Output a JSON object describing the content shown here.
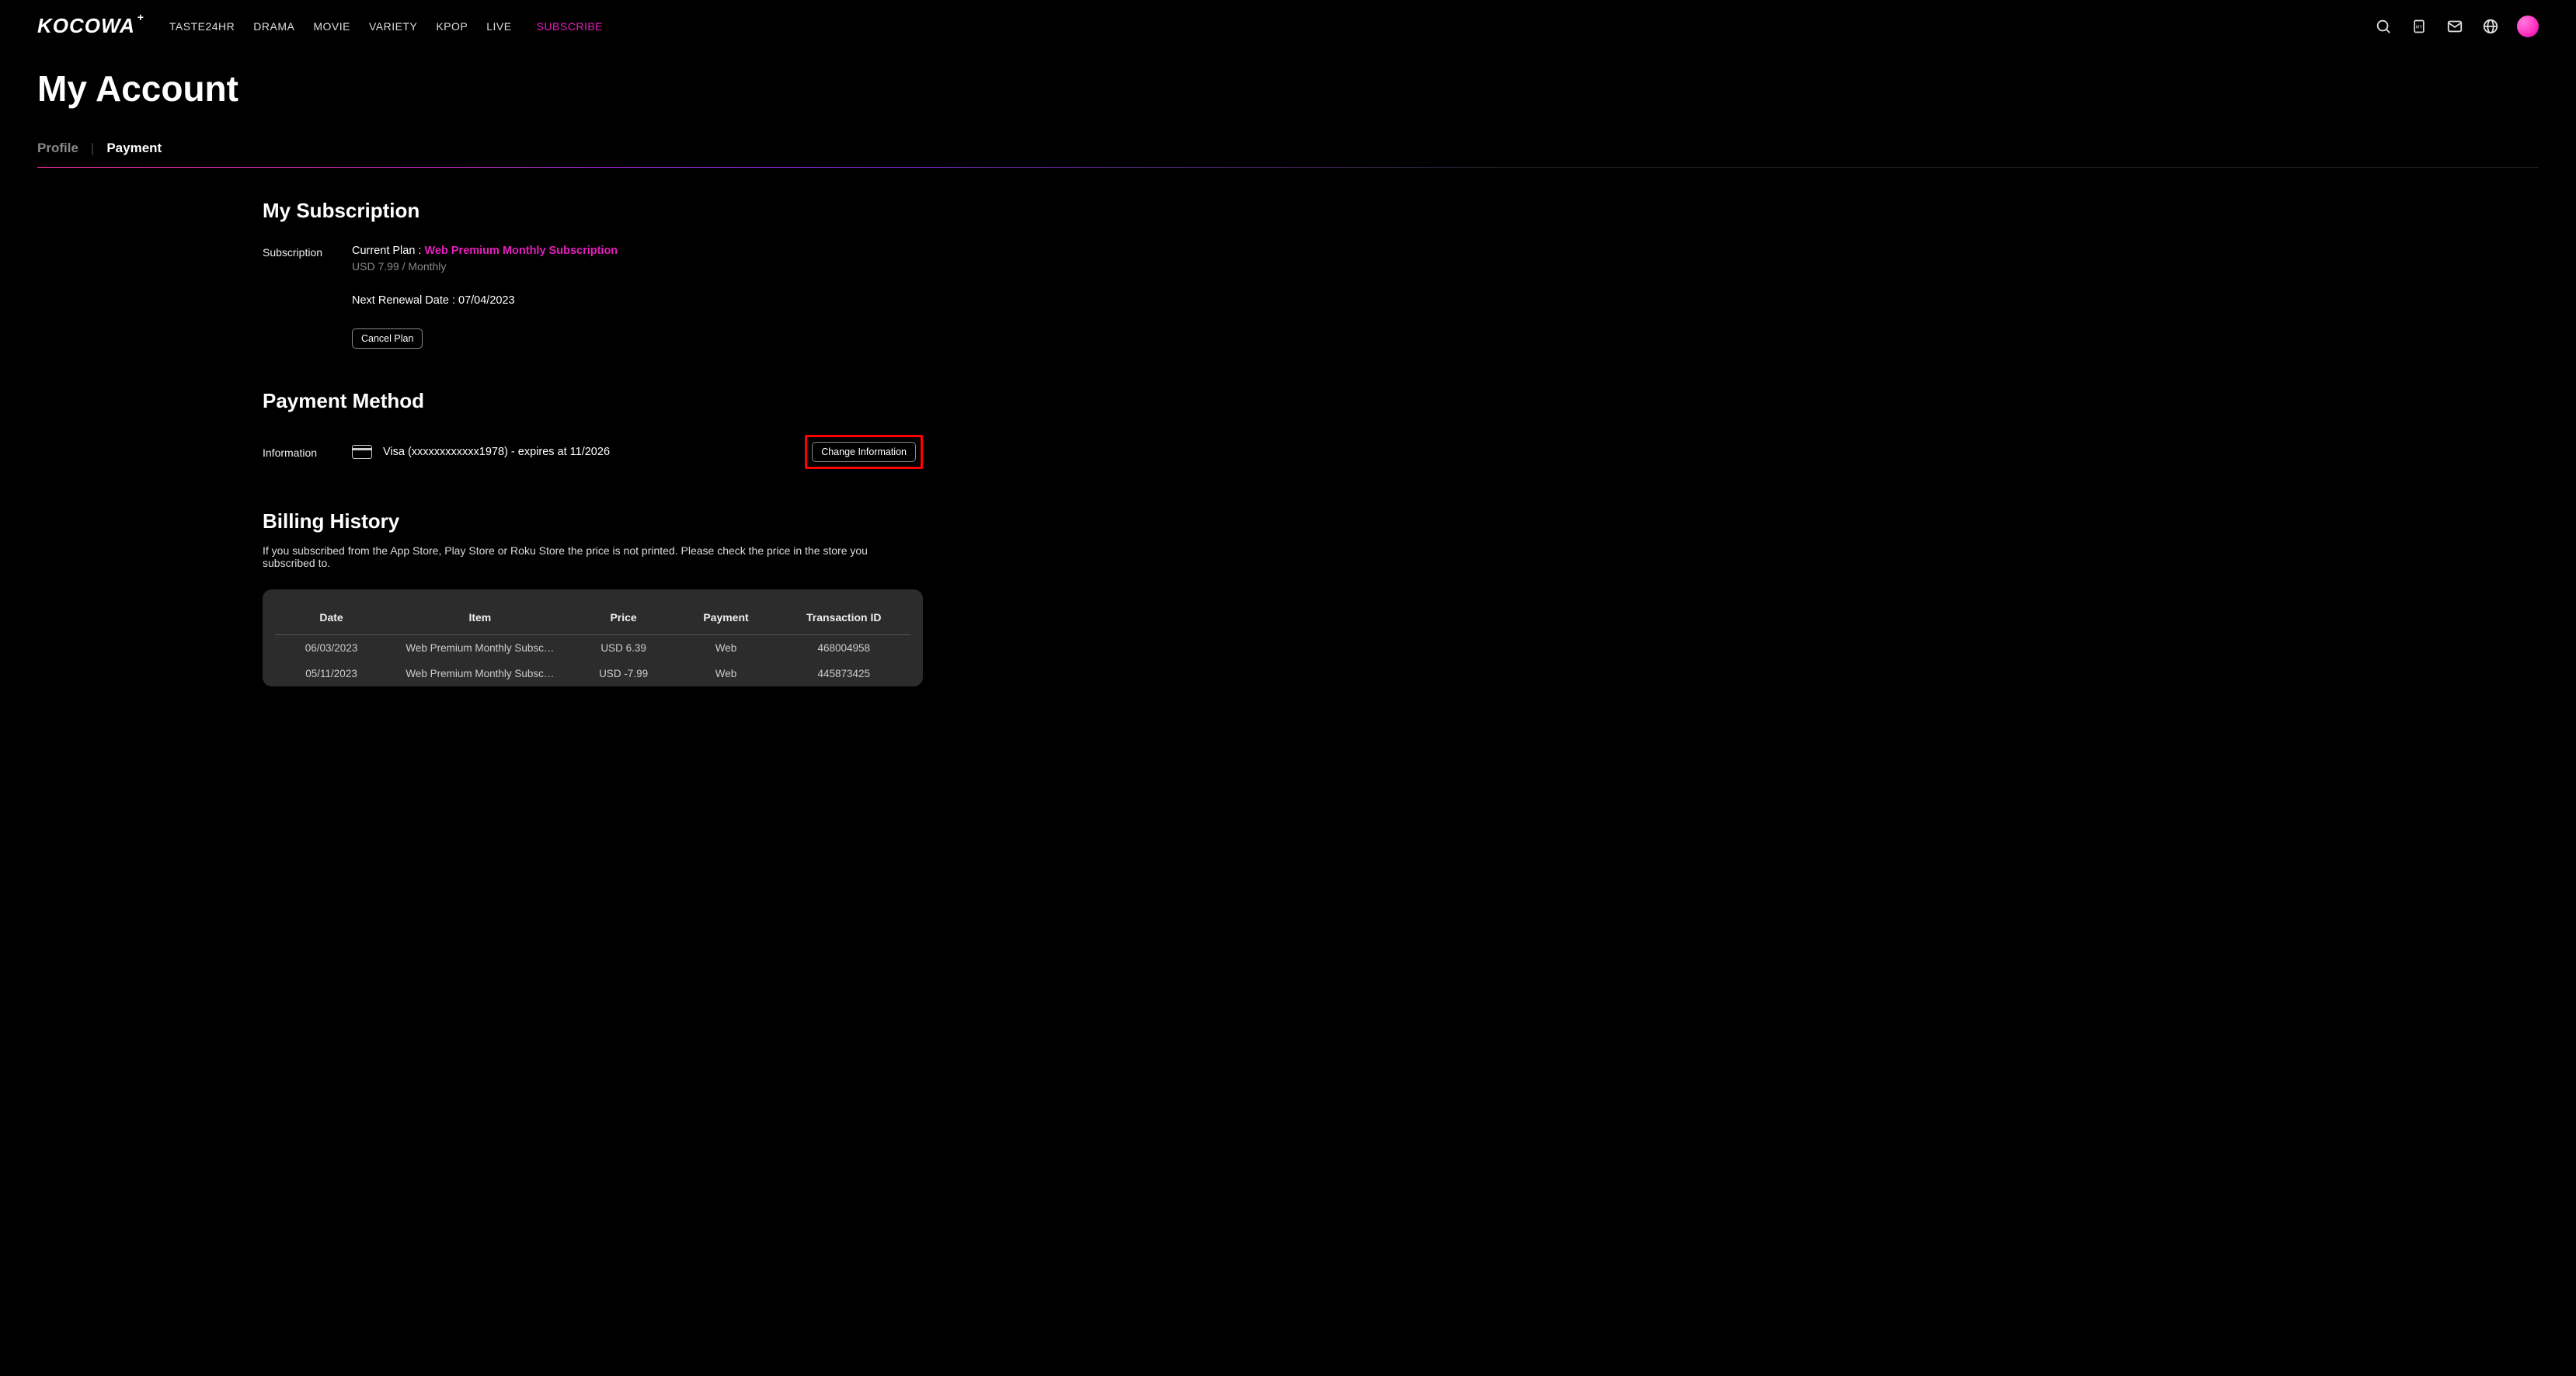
{
  "header": {
    "logo": "KOCOWA",
    "nav": [
      "TASTE24HR",
      "DRAMA",
      "MOVIE",
      "VARIETY",
      "KPOP",
      "LIVE"
    ],
    "subscribe": "SUBSCRIBE"
  },
  "page": {
    "title": "My Account",
    "tabs": {
      "profile": "Profile",
      "payment": "Payment"
    }
  },
  "subscription": {
    "heading": "My Subscription",
    "row_label": "Subscription",
    "plan_prefix": "Current Plan : ",
    "plan_name": "Web Premium Monthly Subscription",
    "price": "USD 7.99 / Monthly",
    "renewal": "Next Renewal Date : 07/04/2023",
    "cancel_label": "Cancel Plan"
  },
  "payment_method": {
    "heading": "Payment Method",
    "row_label": "Information",
    "card_text": "Visa (xxxxxxxxxxxx1978) - expires at 11/2026",
    "change_label": "Change Information"
  },
  "billing": {
    "heading": "Billing History",
    "note": "If you subscribed from the App Store, Play Store or Roku Store the price is not printed. Please check the price in the store you subscribed to.",
    "columns": {
      "date": "Date",
      "item": "Item",
      "price": "Price",
      "payment": "Payment",
      "txn": "Transaction ID"
    },
    "rows": [
      {
        "date": "06/03/2023",
        "item": "Web Premium Monthly Subsc…",
        "price": "USD 6.39",
        "payment": "Web",
        "txn": "468004958"
      },
      {
        "date": "05/11/2023",
        "item": "Web Premium Monthly Subsc…",
        "price": "USD -7.99",
        "payment": "Web",
        "txn": "445873425"
      }
    ]
  }
}
